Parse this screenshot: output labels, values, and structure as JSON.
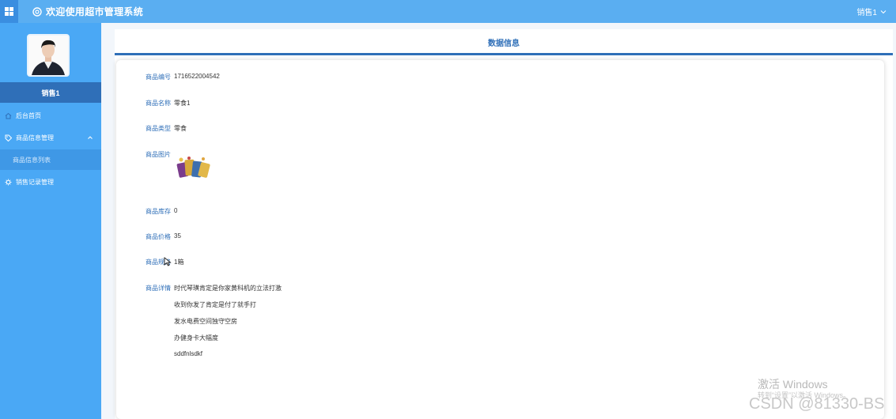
{
  "header": {
    "app_title": "欢迎使用超市管理系统",
    "user_name": "销售1"
  },
  "sidebar": {
    "user_label": "销售1",
    "menu": {
      "home": "后台首页",
      "goods": "商品信息管理",
      "goods_list": "商品信息列表",
      "sales": "销售记录管理"
    }
  },
  "panel": {
    "title": "数据信息"
  },
  "product": {
    "fields": [
      {
        "label": "商品编号",
        "value": "1716522004542"
      },
      {
        "label": "商品名称",
        "value": "零食1"
      },
      {
        "label": "商品类型",
        "value": "零食"
      },
      {
        "label": "商品图片",
        "value": ""
      },
      {
        "label": "商品库存",
        "value": "0"
      },
      {
        "label": "商品价格",
        "value": "35"
      },
      {
        "label": "商品规格",
        "value": "1箱"
      },
      {
        "label": "商品详情",
        "value": "时代琴璜肯定是你家黄科机的立法打激"
      }
    ],
    "detail_lines": [
      "收到你发了肯定是付了就手打",
      "发水电费空间独守空房",
      "办健身卡大幅度",
      "sddfnlsdkf"
    ]
  },
  "watermark": {
    "activate": "激活 Windows",
    "activate_hint": "转到“设置”以激活 Windows。",
    "csdn": "CSDN @81330-BS"
  },
  "colors": {
    "topbar": "#5aaef1",
    "sidebar": "#4aa8f5",
    "accent": "#2f6fb8"
  }
}
